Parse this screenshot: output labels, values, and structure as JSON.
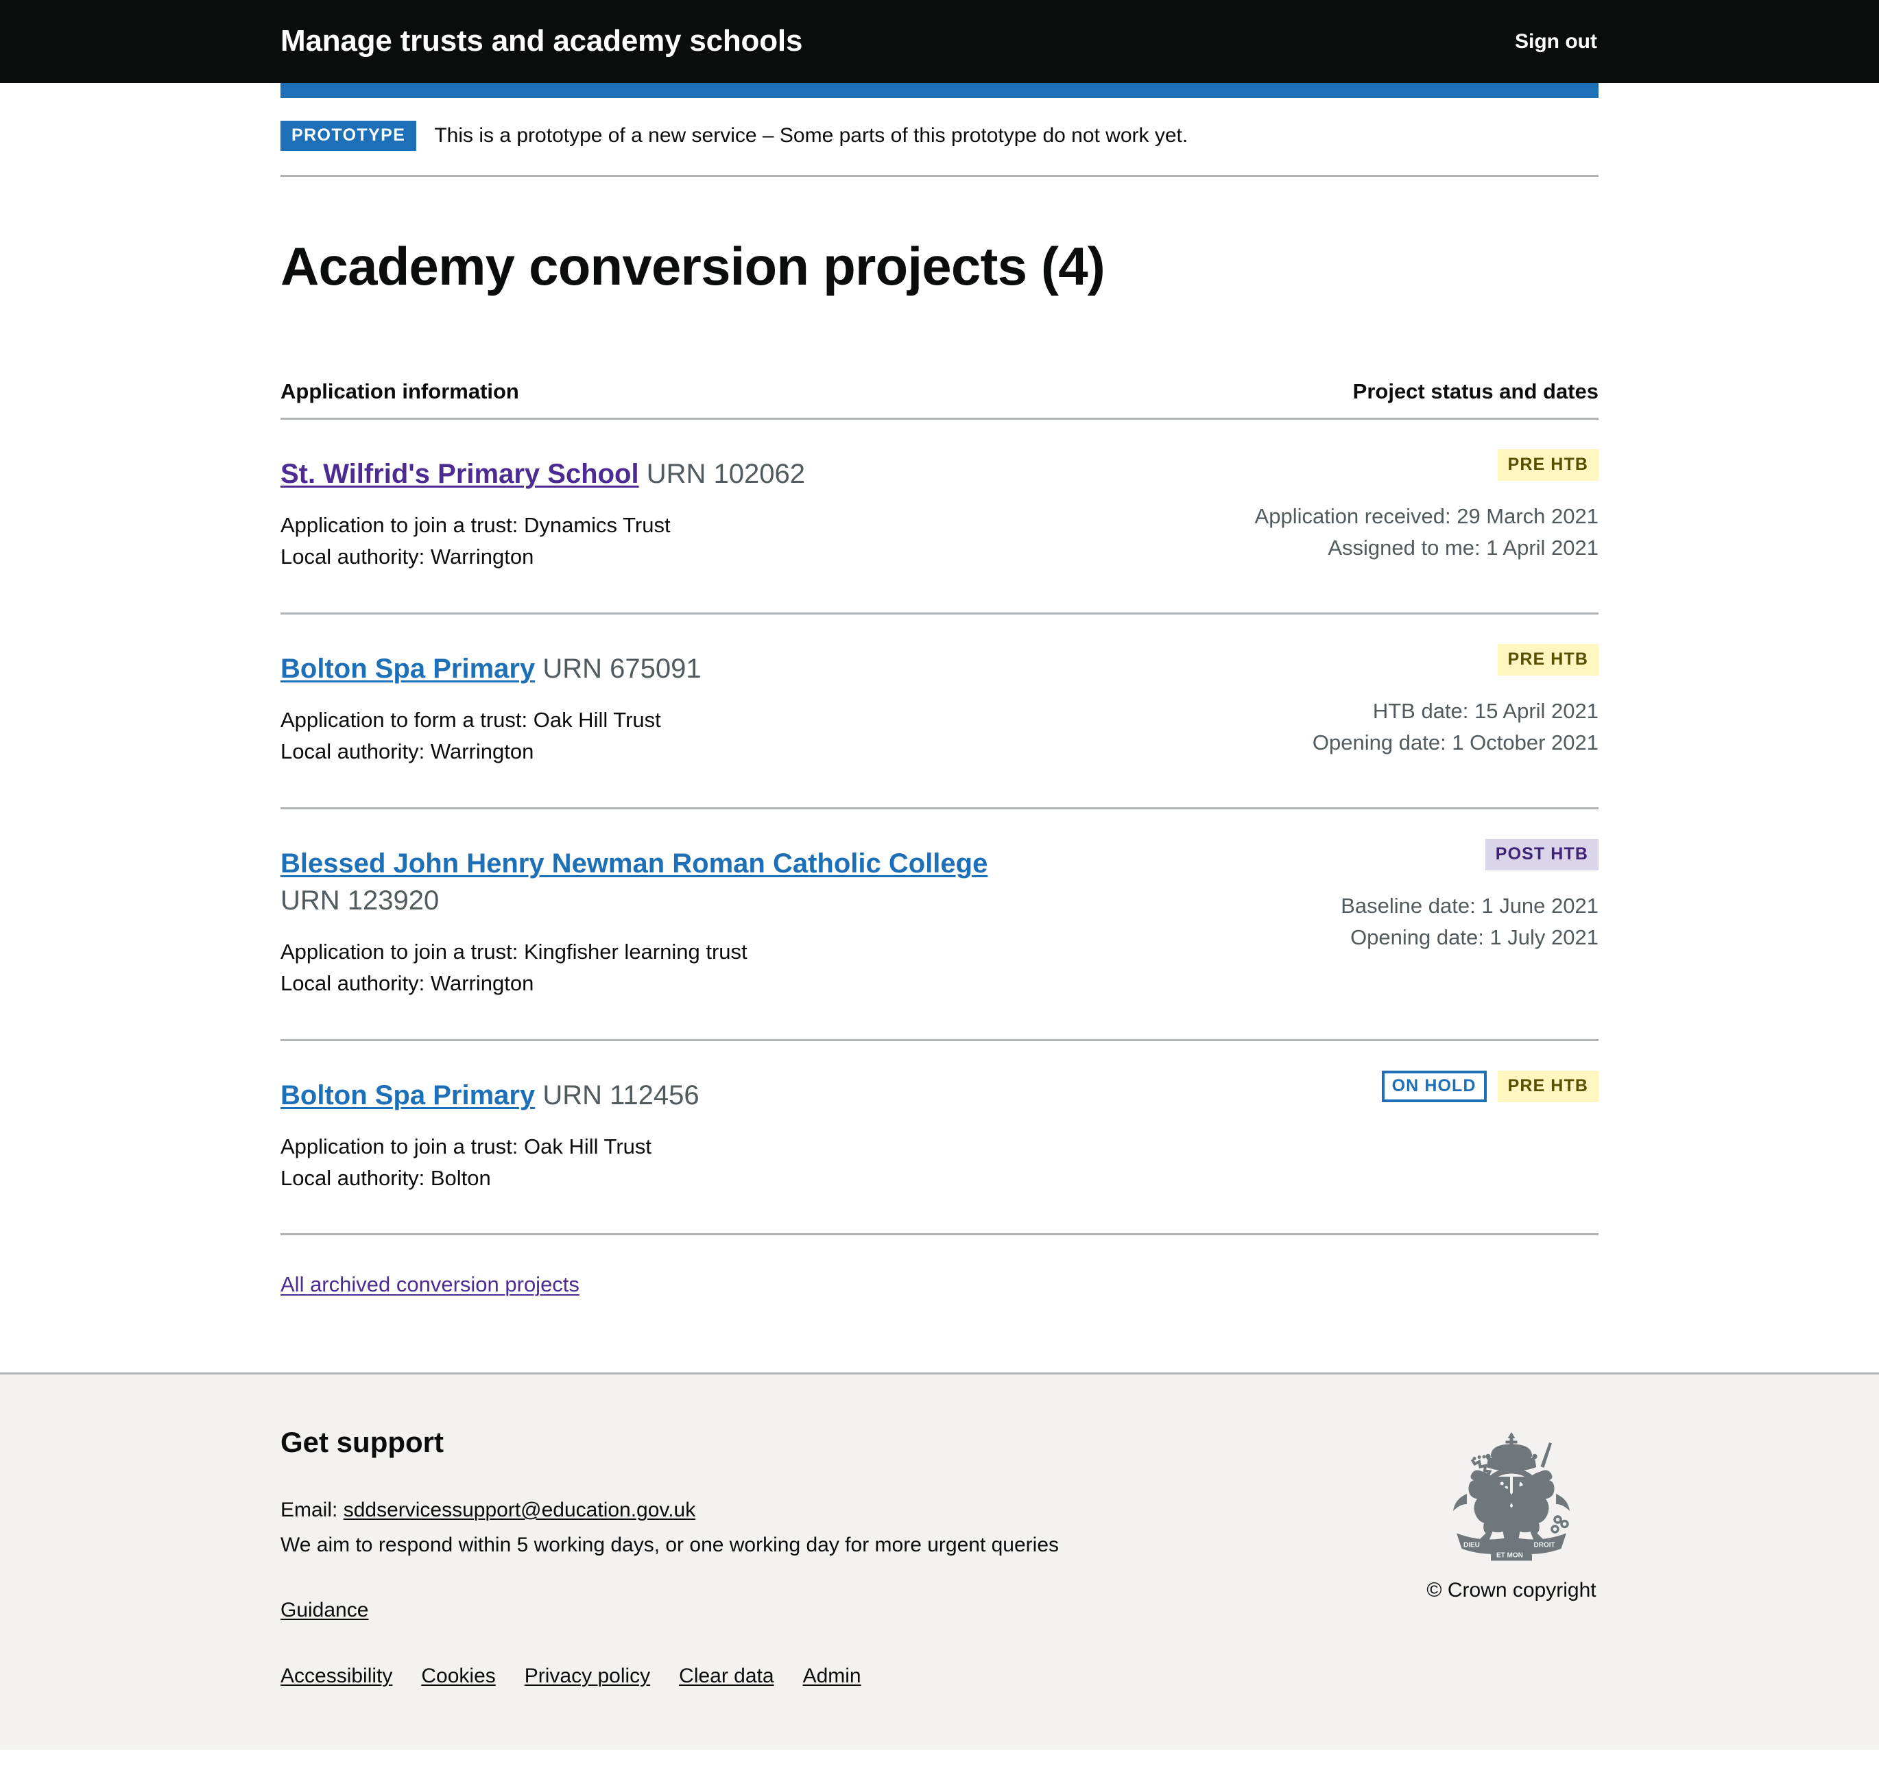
{
  "masthead": {
    "service_name": "Manage trusts and academy schools",
    "sign_out_label": "Sign out"
  },
  "phase_banner": {
    "tag": "PROTOTYPE",
    "text": "This is a prototype of a new service – Some parts of this prototype do not work yet."
  },
  "main": {
    "heading": "Academy conversion projects (4)",
    "column_headers": {
      "left": "Application information",
      "right": "Project status and dates"
    },
    "archived_link": "All archived conversion projects",
    "projects": [
      {
        "school_name": "St. Wilfrid's Primary School",
        "link_state": "visited",
        "urn": "URN 102062",
        "urn_on_new_line": false,
        "application": "Application to join a trust: Dynamics Trust",
        "local_authority": "Local authority: Warrington",
        "tags": [
          {
            "label": "PRE HTB",
            "style": "pre-htb"
          }
        ],
        "dates": [
          "Application received: 29 March 2021",
          "Assigned to me: 1 April 2021"
        ]
      },
      {
        "school_name": "Bolton Spa Primary",
        "link_state": "blue",
        "urn": "URN 675091",
        "urn_on_new_line": false,
        "application": "Application to form a trust: Oak Hill Trust",
        "local_authority": "Local authority: Warrington",
        "tags": [
          {
            "label": "PRE HTB",
            "style": "pre-htb"
          }
        ],
        "dates": [
          "HTB date: 15 April 2021",
          "Opening date: 1 October 2021"
        ]
      },
      {
        "school_name": "Blessed John Henry Newman Roman Catholic College",
        "link_state": "blue",
        "urn": "URN 123920",
        "urn_on_new_line": true,
        "application": "Application to join a trust: Kingfisher learning trust",
        "local_authority": "Local authority: Warrington",
        "tags": [
          {
            "label": "POST HTB",
            "style": "post-htb"
          }
        ],
        "dates": [
          "Baseline date: 1 June 2021",
          "Opening date: 1 July 2021"
        ]
      },
      {
        "school_name": "Bolton Spa Primary",
        "link_state": "blue",
        "urn": "URN 112456",
        "urn_on_new_line": false,
        "application": "Application to join a trust: Oak Hill Trust",
        "local_authority": "Local authority: Bolton",
        "tags": [
          {
            "label": "ON HOLD",
            "style": "on-hold"
          },
          {
            "label": "PRE HTB",
            "style": "pre-htb"
          }
        ],
        "dates": []
      }
    ]
  },
  "footer": {
    "heading": "Get support",
    "email_prefix": "Email:",
    "email_address": "sddservicessupport@education.gov.uk",
    "response_text": "We aim to respond within 5 working days, or one working day for more urgent queries",
    "guidance_label": "Guidance",
    "nav_links": [
      "Accessibility",
      "Cookies",
      "Privacy policy",
      "Clear data",
      "Admin"
    ],
    "copyright": "© Crown copyright"
  },
  "colors": {
    "masthead_bg": "#0b0c0c",
    "accent_blue": "#1d70b8",
    "link_blue": "#1d70b8",
    "link_visited": "#4c2c92",
    "tag_pre_htb_bg": "#fff7bf",
    "tag_pre_htb_text": "#594d00",
    "tag_post_htb_bg": "#dbd5e9",
    "tag_post_htb_text": "#3d2375",
    "border_grey": "#b1b4b6",
    "muted_text": "#505a5f",
    "footer_bg": "#f3f2f1"
  }
}
